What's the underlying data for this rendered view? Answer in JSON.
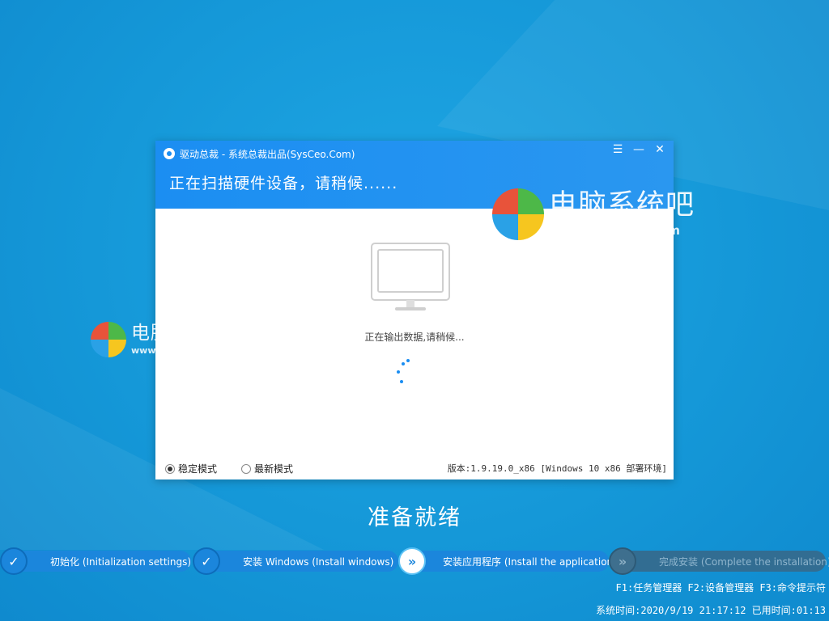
{
  "window": {
    "title": "驱动总裁 - 系统总裁出品(SysCeo.Com)",
    "heading": "正在扫描硬件设备，请稍候......",
    "status": "正在输出数据,请稍候...",
    "modes": [
      {
        "label": "稳定模式",
        "selected": true
      },
      {
        "label": "最新模式",
        "selected": false
      }
    ],
    "version": "版本:1.9.19.0_x86 [Windows 10 x86 部署环境]",
    "controls": {
      "menu": "☰",
      "minimize": "—",
      "close": "✕"
    }
  },
  "watermark": {
    "title": "电脑系统吧",
    "url": "www.dnxitong.com",
    "colors": [
      "#e8533a",
      "#4db848",
      "#2aa1e6",
      "#f6c61f"
    ]
  },
  "ready_text": "准备就绪",
  "steps": [
    {
      "label": "初始化 (Initialization settings)",
      "state": "done",
      "icon": "check-icon"
    },
    {
      "label": "安装 Windows (Install windows)",
      "state": "done",
      "icon": "check-icon"
    },
    {
      "label": "安装应用程序 (Install the application)",
      "state": "active",
      "icon": "double-chevron-icon"
    },
    {
      "label": "完成安装 (Complete the installation)",
      "state": "pending",
      "icon": "double-chevron-icon"
    }
  ],
  "hotkeys": "F1:任务管理器 F2:设备管理器 F3:命令提示符",
  "system_time": "系统时间:2020/9/19 21:17:12 已用时间:01:13",
  "colors": {
    "accent": "#1b8ef2",
    "background": "#1598d8",
    "step_bar": "#1b86dc"
  }
}
